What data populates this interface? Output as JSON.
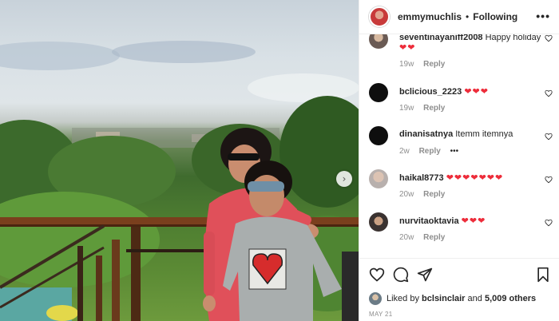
{
  "post": {
    "author": "emmymuchlis",
    "separator": "•",
    "follow_state": "Following",
    "more_icon": "more-dots-icon",
    "photo_next_icon": "chevron-right-icon"
  },
  "comments": [
    {
      "user": "seventinayaniff2008",
      "text": "Happy holiday",
      "hearts": "❤❤",
      "time": "19w",
      "reply": "Reply",
      "extra": ""
    },
    {
      "user": "bclicious_2223",
      "text": "",
      "hearts": "❤❤❤",
      "time": "19w",
      "reply": "Reply",
      "extra": ""
    },
    {
      "user": "dinanisatnya",
      "text": "Itemm itemnya",
      "hearts": "",
      "time": "2w",
      "reply": "Reply",
      "extra": "•••"
    },
    {
      "user": "haikal8773",
      "text": "",
      "hearts": "❤❤❤❤❤❤❤",
      "time": "20w",
      "reply": "Reply",
      "extra": ""
    },
    {
      "user": "nurvitaoktavia",
      "text": "",
      "hearts": "❤❤❤",
      "time": "20w",
      "reply": "Reply",
      "extra": ""
    }
  ],
  "actions": {
    "like_icon": "heart-outline-icon",
    "comment_icon": "comment-bubble-icon",
    "share_icon": "paper-plane-icon",
    "save_icon": "bookmark-icon"
  },
  "likes": {
    "prefix": "Liked by",
    "user": "bclsinclair",
    "and": "and",
    "others": "5,009 others"
  },
  "date": "MAY 21",
  "colors": {
    "heart_red": "#ed2c3a",
    "meta_gray": "#8e8e8e",
    "border": "#efefef"
  }
}
